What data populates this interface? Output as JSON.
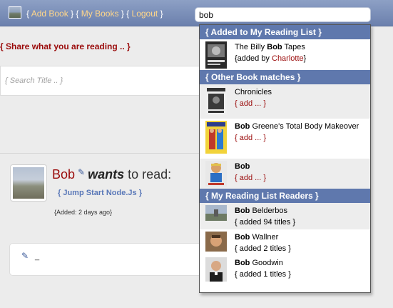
{
  "nav": {
    "open_brace": "{",
    "add_book": "Add Book",
    "my_books": "My Books",
    "logout": "Logout",
    "sep": "} {",
    "close_brace": "}"
  },
  "search": {
    "value": "bob"
  },
  "share_title": "{ Share what you are reading .. }",
  "title_search": {
    "placeholder": "{ Search Title .. }"
  },
  "feed": {
    "user": "Bob",
    "verb": "wants",
    "rest": " to read:",
    "book": "{ Jump Start Node.Js }",
    "added": "{Added: 2 days ago}"
  },
  "comment": {
    "text": "_"
  },
  "dropdown": {
    "sections": [
      {
        "title": "{ Added to My Reading List }"
      },
      {
        "title": "{ Other Book matches }"
      },
      {
        "title": "{ My Reading List Readers }"
      }
    ],
    "reading_list": [
      {
        "pre": "The Billy ",
        "bold": "Bob",
        "post": " Tapes",
        "added_pre": "{added by ",
        "added_by": "Charlotte",
        "added_post": "}"
      }
    ],
    "book_matches": [
      {
        "pre": "",
        "bold": "",
        "post": "Chronicles",
        "action": "{ add ... }"
      },
      {
        "pre": "",
        "bold": "Bob",
        "post": " Greene's Total Body Makeover",
        "action": "{ add ... }"
      },
      {
        "pre": "",
        "bold": "Bob",
        "post": "",
        "action": "{ add ... }"
      }
    ],
    "readers": [
      {
        "bold": "Bob",
        "post": " Belderbos",
        "titles": "{ added 94 titles }"
      },
      {
        "bold": "Bob",
        "post": " Wallner",
        "titles": "{ added 2 titles }"
      },
      {
        "bold": "Bob",
        "post": " Goodwin",
        "titles": "{ added 1 titles }"
      }
    ]
  }
}
